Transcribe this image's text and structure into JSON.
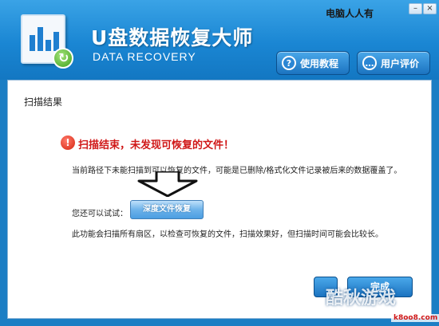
{
  "header": {
    "title": "U盘数据恢复大师",
    "subtitle": "DATA RECOVERY",
    "brand": "电脑人人有",
    "tutorial_label": "使用教程",
    "review_label": "用户评价",
    "tutorial_icon": "question-icon",
    "review_icon": "speech-bubble-icon"
  },
  "window": {
    "minimize": "–",
    "close": "×"
  },
  "panel": {
    "title": "扫描结果",
    "error_message": "扫描结束，未发现可恢复的文件！",
    "info_text": "当前路径下未能扫描到可以恢复的文件，可能是已删除/格式化文件记录被后来的数据覆盖了。",
    "try_label": "您还可以试试：",
    "deep_scan_label": "深度文件恢复",
    "description": "此功能会扫描所有扇区，以检查可恢复的文件，扫描效果好，但扫描时间可能会比较长。",
    "done_label": "完成"
  },
  "watermark": {
    "text": "酷秋游戏",
    "sub": "k8oo8.com"
  },
  "colors": {
    "header_blue": "#1a86d3",
    "error_red": "#d01818"
  }
}
